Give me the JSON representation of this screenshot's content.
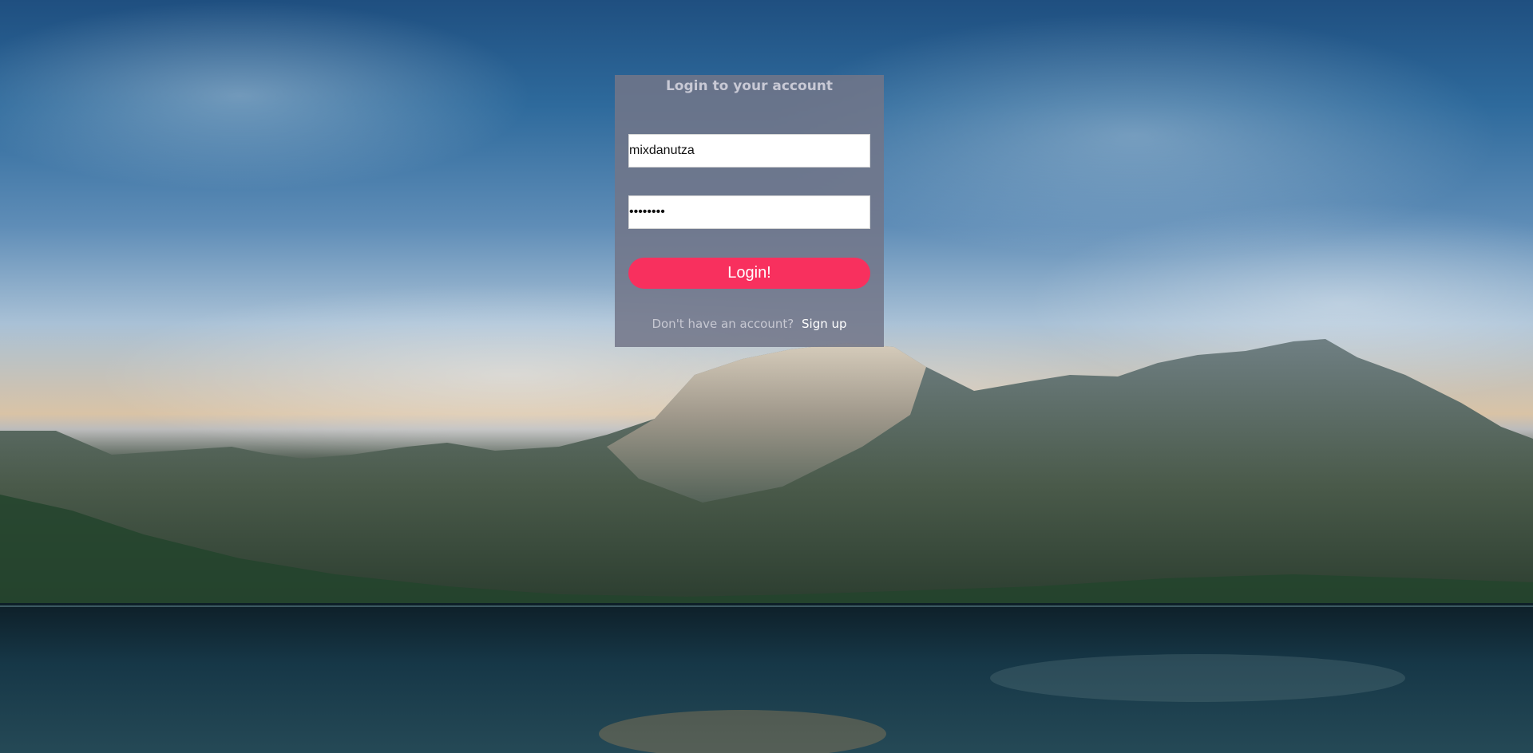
{
  "login": {
    "title": "Login to your account",
    "username_value": "mixdanutza",
    "password_value": "12345678",
    "button_label": "Login!",
    "signup_prompt": "Don't have an account?",
    "signup_link": "Sign up"
  },
  "colors": {
    "button": "#f8305e",
    "card": "#727688"
  }
}
